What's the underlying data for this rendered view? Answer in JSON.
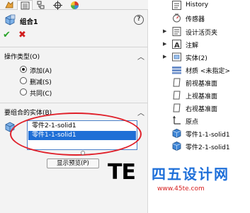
{
  "property_manager": {
    "title": "组合1",
    "help_glyph": "?",
    "ok_glyph": "✔",
    "cancel_glyph": "✖",
    "tabs": [
      "features-tab",
      "propertymanager-tab",
      "configuration-tab",
      "dimxpert-tab",
      "display-tab"
    ],
    "operation_section": {
      "title": "操作类型(O)",
      "options": [
        {
          "label": "添加(A)",
          "selected": true
        },
        {
          "label": "删减(S)",
          "selected": false
        },
        {
          "label": "共同(C)",
          "selected": false
        }
      ]
    },
    "bodies_section": {
      "title": "要组合的实体(B)",
      "items": [
        {
          "label": "零件2-1-solid1",
          "highlighted": false
        },
        {
          "label": "零件1-1-solid1",
          "highlighted": true
        }
      ],
      "preview_button": "显示预览(P)"
    }
  },
  "feature_tree": {
    "nodes": [
      {
        "label": "History",
        "icon": "history-icon",
        "expandable": false
      },
      {
        "label": "传感器",
        "icon": "sensor-icon",
        "expandable": false
      },
      {
        "label": "设计活页夹",
        "icon": "design-binder-icon",
        "expandable": true
      },
      {
        "label": "注解",
        "icon": "annotation-icon",
        "expandable": true
      },
      {
        "label": "实体(2)",
        "icon": "solid-bodies-icon",
        "expandable": true
      },
      {
        "label": "材质 <未指定>",
        "icon": "material-icon",
        "expandable": false
      },
      {
        "label": "前视基准面",
        "icon": "plane-icon",
        "expandable": false
      },
      {
        "label": "上视基准面",
        "icon": "plane-icon",
        "expandable": false
      },
      {
        "label": "右视基准面",
        "icon": "plane-icon",
        "expandable": false
      },
      {
        "label": "原点",
        "icon": "origin-icon",
        "expandable": false
      },
      {
        "label": "零件1-1-solid1",
        "icon": "part-body-icon",
        "expandable": false
      },
      {
        "label": "零件2-1-solid1",
        "icon": "part-body-icon",
        "expandable": false
      }
    ]
  },
  "watermark": {
    "logo_text": "TE",
    "name": "四五设计网",
    "url": "www.45te.com"
  },
  "colors": {
    "accent_blue": "#1f6fd6",
    "highlight_ellipse": "#e0202a",
    "ok_green": "#2aa32a",
    "cancel_red": "#d11d1d"
  }
}
